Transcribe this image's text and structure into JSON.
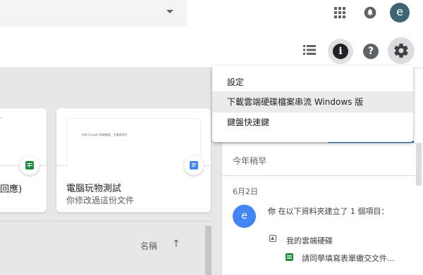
{
  "topbar": {
    "account_initial": "e"
  },
  "toolbar": {
    "info_symbol": "i",
    "help_symbol": "?"
  },
  "settings_menu": {
    "items": [
      {
        "label": "設定"
      },
      {
        "label": "下載雲端硬碟檔案串流 Windows 版"
      },
      {
        "label": "鍵盤快速鍵"
      }
    ]
  },
  "files": [
    {
      "title": "回應)",
      "type_icon": "sheets-icon",
      "thumbnail_text": "•"
    },
    {
      "title": "電腦玩物測試",
      "subtitle": "你修改過這份文件",
      "type_icon": "docs-icon",
      "thumbnail_text": "用來 Google 雲端硬碟，文書處理作"
    }
  ],
  "sort": {
    "label": "名稱",
    "direction_symbol": "↑"
  },
  "activity_panel": {
    "section_label": "今年稍早",
    "date_label": "6月2日",
    "entry": {
      "avatar_initial": "e",
      "actor": "你",
      "action": " 在以下資料夾建立了 1 個項目：",
      "folder": "我的雲端硬碟",
      "item": "請同學填寫表單繳交文件..."
    }
  },
  "colors": {
    "accent_blue": "#1a73e8",
    "sheets_green": "#1e8e3e",
    "docs_blue": "#4285f4",
    "avatar_top": "#3f6473"
  }
}
